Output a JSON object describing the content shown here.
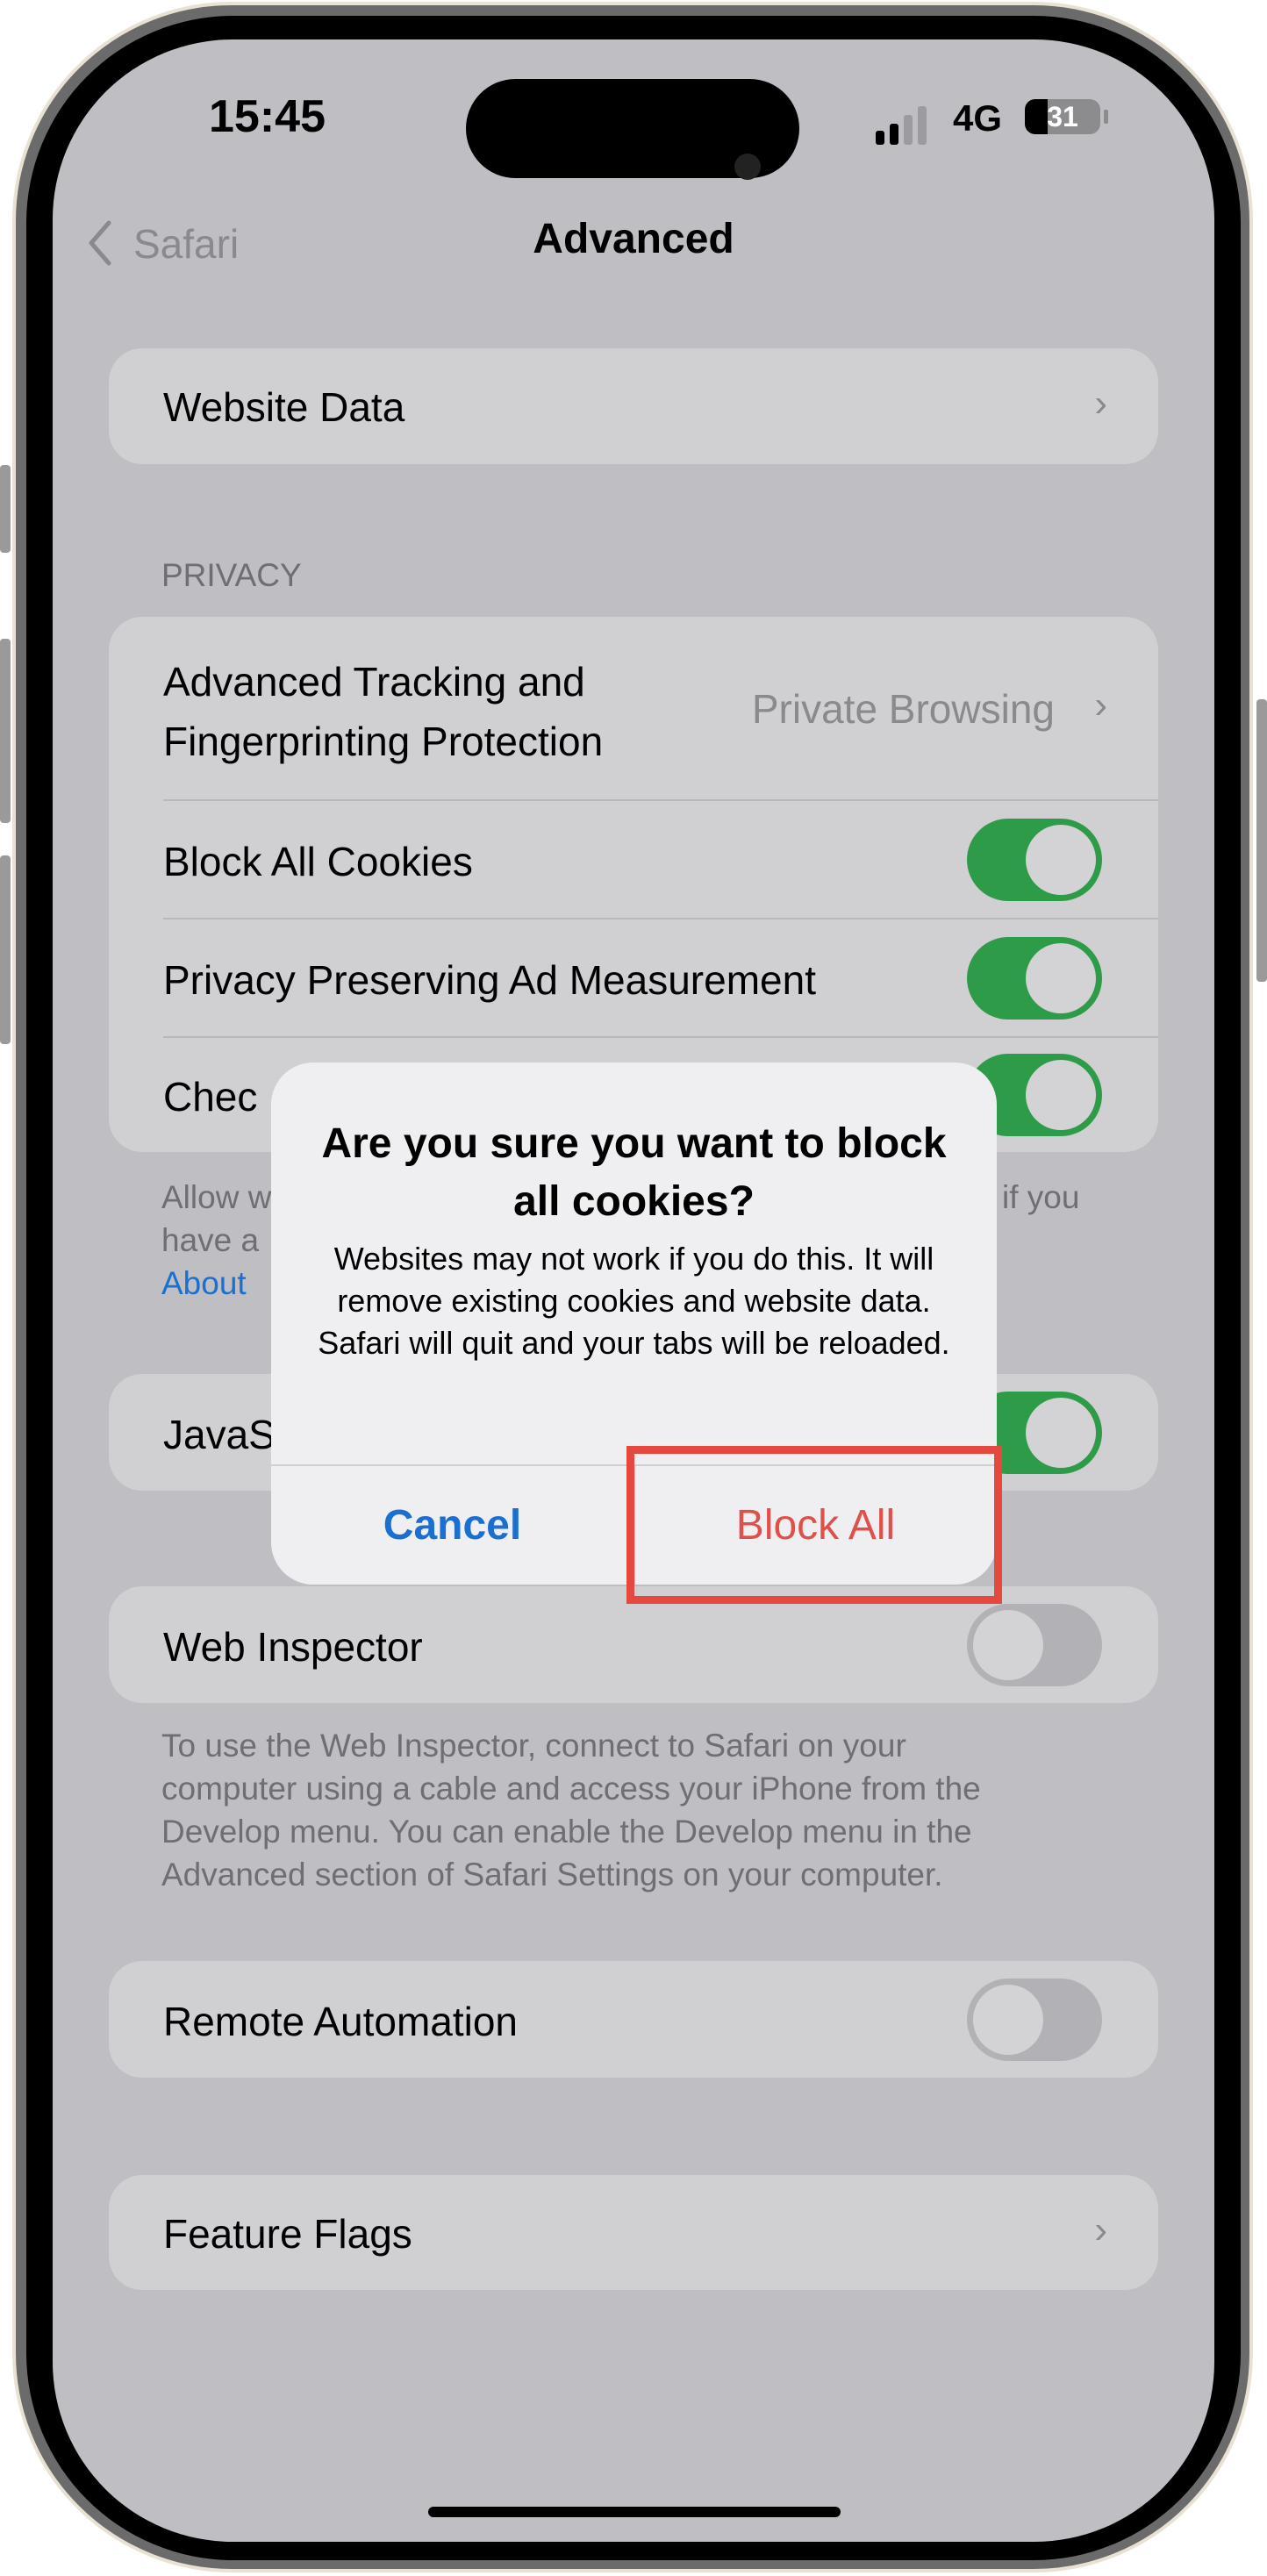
{
  "status_bar": {
    "time": "15:45",
    "network": "4G",
    "battery": "31",
    "signal_bars_active": 2,
    "signal_bars_total": 4
  },
  "nav": {
    "back_label": "Safari",
    "title": "Advanced",
    "back_icon": "chevron-left-icon"
  },
  "website_data": {
    "label": "Website Data"
  },
  "privacy": {
    "header": "PRIVACY",
    "tracking_label_line1": "Advanced Tracking and",
    "tracking_label_line2": "Fingerprinting Protection",
    "tracking_value": "Private Browsing",
    "block_cookies": {
      "label": "Block All Cookies",
      "on": true
    },
    "ad_measurement": {
      "label": "Privacy Preserving Ad Measurement",
      "on": true
    },
    "check_partial": {
      "label": "Chec",
      "on": true
    },
    "footer_fragments": {
      "line1_left": "Allow w",
      "line1_right": "if you",
      "line2_left": "have a",
      "line3_link": "About"
    }
  },
  "javascript_partial": {
    "label": "JavaS",
    "on": true
  },
  "web_inspector": {
    "label": "Web Inspector",
    "on": false,
    "footer": [
      "To use the Web Inspector, connect to Safari on your",
      "computer using a cable and access your iPhone from the",
      "Develop menu. You can enable the Develop menu in the",
      "Advanced section of Safari Settings on your computer."
    ]
  },
  "remote_automation": {
    "label": "Remote Automation",
    "on": false
  },
  "feature_flags": {
    "label": "Feature Flags"
  },
  "dialog": {
    "title": "Are you sure you want to block all cookies?",
    "message": "Websites may not work if you do this. It will remove existing cookies and website data. Safari will quit and your tabs will be reloaded.",
    "cancel_label": "Cancel",
    "confirm_label": "Block All"
  },
  "colors": {
    "accent_blue": "#1a6fd0",
    "destructive_red": "#e0504a",
    "toggle_green": "#2e9b49",
    "highlight_box": "#e5483f"
  }
}
